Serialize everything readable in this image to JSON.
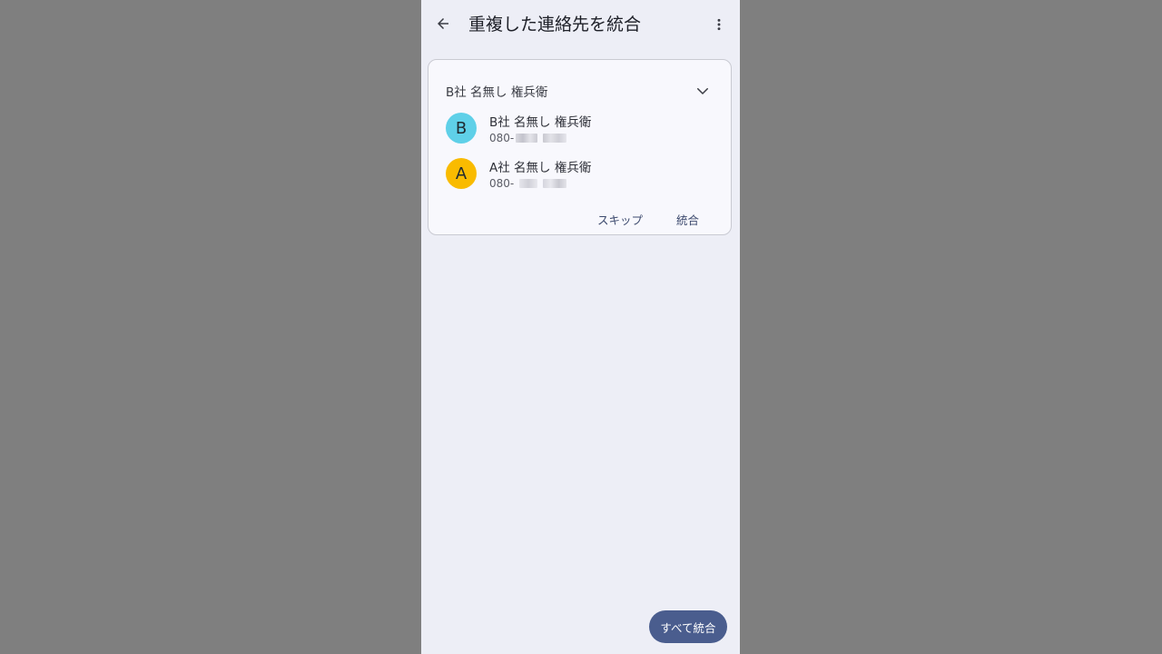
{
  "appbar": {
    "title": "重複した連絡先を統合",
    "back_icon": "arrow-back-icon",
    "menu_icon": "more-vert-icon"
  },
  "card": {
    "header": "B社 名無し 権兵衛",
    "expand_icon": "chevron-down-icon",
    "contacts": [
      {
        "initial": "B",
        "name": "B社 名無し 権兵衛",
        "phone_prefix": "080-",
        "avatar_color": "#5fd0e8"
      },
      {
        "initial": "A",
        "name": "A社 名無し 権兵衛",
        "phone_prefix": "080-",
        "avatar_color": "#f9bb00"
      }
    ],
    "skip_label": "スキップ",
    "merge_label": "統合"
  },
  "merge_all_label": "すべて統合",
  "colors": {
    "background": "#edeef6",
    "card": "#f8f8fd",
    "accent": "#4a5d8e",
    "outer": "#7f7f7f"
  }
}
